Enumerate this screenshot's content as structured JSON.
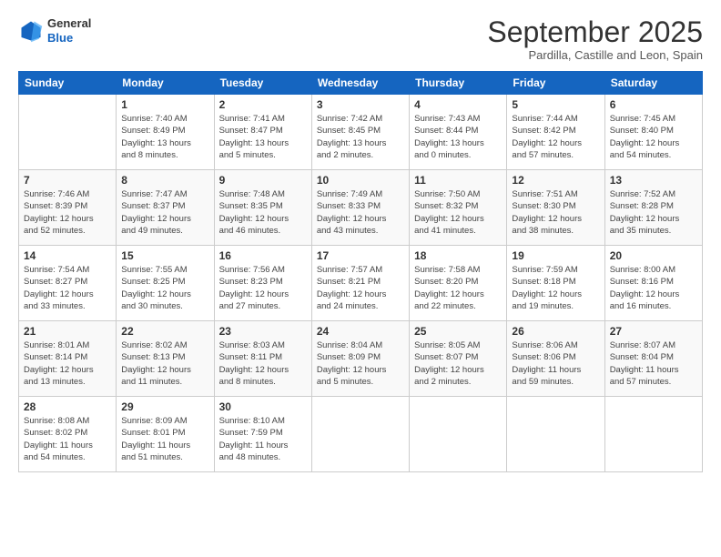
{
  "header": {
    "logo_line1": "General",
    "logo_line2": "Blue",
    "month_title": "September 2025",
    "subtitle": "Pardilla, Castille and Leon, Spain"
  },
  "weekdays": [
    "Sunday",
    "Monday",
    "Tuesday",
    "Wednesday",
    "Thursday",
    "Friday",
    "Saturday"
  ],
  "weeks": [
    [
      {
        "day": "",
        "info": ""
      },
      {
        "day": "1",
        "info": "Sunrise: 7:40 AM\nSunset: 8:49 PM\nDaylight: 13 hours\nand 8 minutes."
      },
      {
        "day": "2",
        "info": "Sunrise: 7:41 AM\nSunset: 8:47 PM\nDaylight: 13 hours\nand 5 minutes."
      },
      {
        "day": "3",
        "info": "Sunrise: 7:42 AM\nSunset: 8:45 PM\nDaylight: 13 hours\nand 2 minutes."
      },
      {
        "day": "4",
        "info": "Sunrise: 7:43 AM\nSunset: 8:44 PM\nDaylight: 13 hours\nand 0 minutes."
      },
      {
        "day": "5",
        "info": "Sunrise: 7:44 AM\nSunset: 8:42 PM\nDaylight: 12 hours\nand 57 minutes."
      },
      {
        "day": "6",
        "info": "Sunrise: 7:45 AM\nSunset: 8:40 PM\nDaylight: 12 hours\nand 54 minutes."
      }
    ],
    [
      {
        "day": "7",
        "info": "Sunrise: 7:46 AM\nSunset: 8:39 PM\nDaylight: 12 hours\nand 52 minutes."
      },
      {
        "day": "8",
        "info": "Sunrise: 7:47 AM\nSunset: 8:37 PM\nDaylight: 12 hours\nand 49 minutes."
      },
      {
        "day": "9",
        "info": "Sunrise: 7:48 AM\nSunset: 8:35 PM\nDaylight: 12 hours\nand 46 minutes."
      },
      {
        "day": "10",
        "info": "Sunrise: 7:49 AM\nSunset: 8:33 PM\nDaylight: 12 hours\nand 43 minutes."
      },
      {
        "day": "11",
        "info": "Sunrise: 7:50 AM\nSunset: 8:32 PM\nDaylight: 12 hours\nand 41 minutes."
      },
      {
        "day": "12",
        "info": "Sunrise: 7:51 AM\nSunset: 8:30 PM\nDaylight: 12 hours\nand 38 minutes."
      },
      {
        "day": "13",
        "info": "Sunrise: 7:52 AM\nSunset: 8:28 PM\nDaylight: 12 hours\nand 35 minutes."
      }
    ],
    [
      {
        "day": "14",
        "info": "Sunrise: 7:54 AM\nSunset: 8:27 PM\nDaylight: 12 hours\nand 33 minutes."
      },
      {
        "day": "15",
        "info": "Sunrise: 7:55 AM\nSunset: 8:25 PM\nDaylight: 12 hours\nand 30 minutes."
      },
      {
        "day": "16",
        "info": "Sunrise: 7:56 AM\nSunset: 8:23 PM\nDaylight: 12 hours\nand 27 minutes."
      },
      {
        "day": "17",
        "info": "Sunrise: 7:57 AM\nSunset: 8:21 PM\nDaylight: 12 hours\nand 24 minutes."
      },
      {
        "day": "18",
        "info": "Sunrise: 7:58 AM\nSunset: 8:20 PM\nDaylight: 12 hours\nand 22 minutes."
      },
      {
        "day": "19",
        "info": "Sunrise: 7:59 AM\nSunset: 8:18 PM\nDaylight: 12 hours\nand 19 minutes."
      },
      {
        "day": "20",
        "info": "Sunrise: 8:00 AM\nSunset: 8:16 PM\nDaylight: 12 hours\nand 16 minutes."
      }
    ],
    [
      {
        "day": "21",
        "info": "Sunrise: 8:01 AM\nSunset: 8:14 PM\nDaylight: 12 hours\nand 13 minutes."
      },
      {
        "day": "22",
        "info": "Sunrise: 8:02 AM\nSunset: 8:13 PM\nDaylight: 12 hours\nand 11 minutes."
      },
      {
        "day": "23",
        "info": "Sunrise: 8:03 AM\nSunset: 8:11 PM\nDaylight: 12 hours\nand 8 minutes."
      },
      {
        "day": "24",
        "info": "Sunrise: 8:04 AM\nSunset: 8:09 PM\nDaylight: 12 hours\nand 5 minutes."
      },
      {
        "day": "25",
        "info": "Sunrise: 8:05 AM\nSunset: 8:07 PM\nDaylight: 12 hours\nand 2 minutes."
      },
      {
        "day": "26",
        "info": "Sunrise: 8:06 AM\nSunset: 8:06 PM\nDaylight: 11 hours\nand 59 minutes."
      },
      {
        "day": "27",
        "info": "Sunrise: 8:07 AM\nSunset: 8:04 PM\nDaylight: 11 hours\nand 57 minutes."
      }
    ],
    [
      {
        "day": "28",
        "info": "Sunrise: 8:08 AM\nSunset: 8:02 PM\nDaylight: 11 hours\nand 54 minutes."
      },
      {
        "day": "29",
        "info": "Sunrise: 8:09 AM\nSunset: 8:01 PM\nDaylight: 11 hours\nand 51 minutes."
      },
      {
        "day": "30",
        "info": "Sunrise: 8:10 AM\nSunset: 7:59 PM\nDaylight: 11 hours\nand 48 minutes."
      },
      {
        "day": "",
        "info": ""
      },
      {
        "day": "",
        "info": ""
      },
      {
        "day": "",
        "info": ""
      },
      {
        "day": "",
        "info": ""
      }
    ]
  ]
}
